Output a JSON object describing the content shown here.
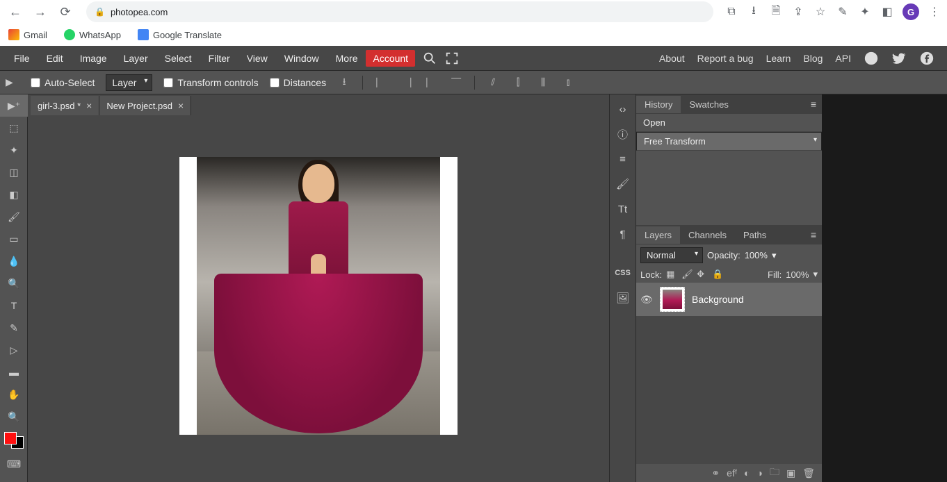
{
  "browser": {
    "url": "photopea.com",
    "bookmarks": [
      {
        "label": "Gmail"
      },
      {
        "label": "WhatsApp"
      },
      {
        "label": "Google Translate"
      }
    ],
    "profile_letter": "G"
  },
  "menubar": {
    "items": [
      "File",
      "Edit",
      "Image",
      "Layer",
      "Select",
      "Filter",
      "View",
      "Window",
      "More"
    ],
    "account": "Account",
    "right_links": [
      "About",
      "Report a bug",
      "Learn",
      "Blog",
      "API"
    ]
  },
  "optionsbar": {
    "auto_select": "Auto-Select",
    "layer_select": "Layer",
    "transform_controls": "Transform controls",
    "distances": "Distances"
  },
  "tabs": [
    {
      "label": "girl-3.psd *"
    },
    {
      "label": "New Project.psd"
    }
  ],
  "history_panel": {
    "tabs": [
      "History",
      "Swatches"
    ],
    "items": [
      "Open",
      "Free Transform"
    ]
  },
  "layers_panel": {
    "tabs": [
      "Layers",
      "Channels",
      "Paths"
    ],
    "blend_mode": "Normal",
    "opacity_label": "Opacity:",
    "opacity_value": "100%",
    "lock_label": "Lock:",
    "fill_label": "Fill:",
    "fill_value": "100%",
    "layers": [
      {
        "name": "Background"
      }
    ]
  },
  "colors": {
    "foreground": "#ff1010",
    "background": "#000000"
  }
}
